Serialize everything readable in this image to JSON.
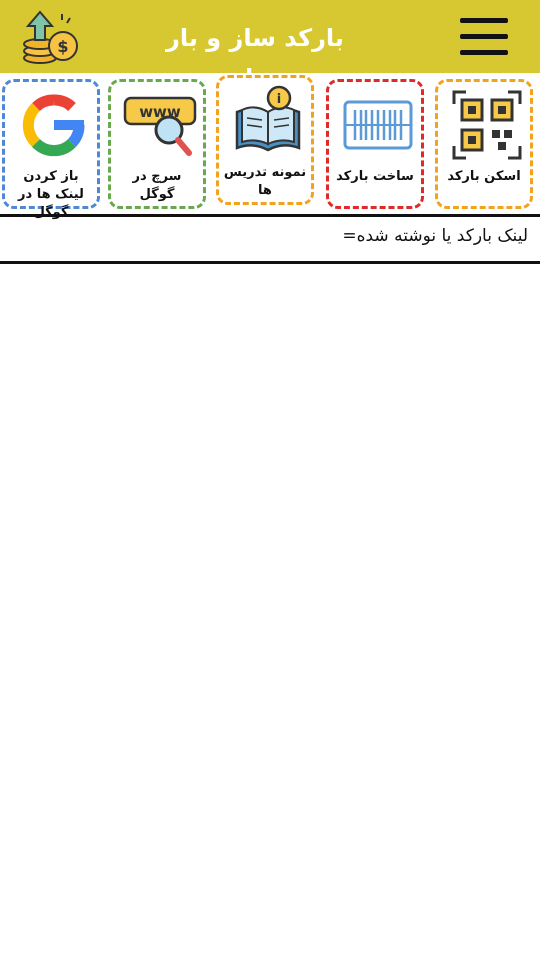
{
  "appbar": {
    "title": "بارکد ساز و بار خوان",
    "logo_icon": "coin-growth-icon",
    "menu_icon": "hamburger-menu-icon",
    "color": "#d7c832"
  },
  "tiles": [
    {
      "label": "باز کردن لینک ها در گوگل",
      "icon": "google-icon",
      "border_color": "#4f88d6"
    },
    {
      "label": "سرچ در گوگل",
      "icon": "www-search-icon",
      "border_color": "#6aa84f"
    },
    {
      "label": "نمونه تدریس ها",
      "icon": "book-info-icon",
      "border_color": "#f2a31d"
    },
    {
      "label": "ساخت بارکد",
      "icon": "barcode-icon",
      "border_color": "#e02a2a"
    },
    {
      "label": "اسکن بارکد",
      "icon": "qr-code-icon",
      "border_color": "#f2a31d"
    }
  ],
  "result": {
    "text": "لینک بارکد یا نوشته شده="
  }
}
